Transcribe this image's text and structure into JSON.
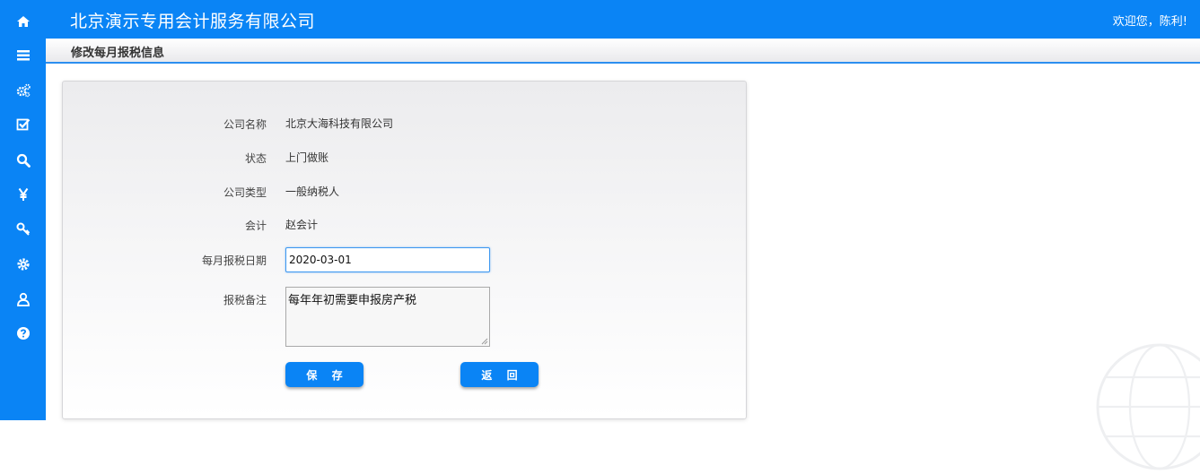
{
  "header": {
    "company_title": "北京演示专用会计服务有限公司",
    "welcome_text": "欢迎您，陈利!"
  },
  "page": {
    "title": "修改每月报税信息"
  },
  "sidebar": {
    "icons": [
      "home-icon",
      "list-icon",
      "gears-icon",
      "checkbox-icon",
      "search-icon",
      "yen-icon",
      "key-icon",
      "settings-icon",
      "user-icon",
      "help-icon"
    ],
    "accent_color": "#0a84f5"
  },
  "form": {
    "company_name_label": "公司名称",
    "company_name_value": "北京大海科技有限公司",
    "status_label": "状态",
    "status_value": "上门做账",
    "company_type_label": "公司类型",
    "company_type_value": "一般纳税人",
    "accountant_label": "会计",
    "accountant_value": "赵会计",
    "tax_date_label": "每月报税日期",
    "tax_date_value": "2020-03-01",
    "tax_note_label": "报税备注",
    "tax_note_value": "每年年初需要申报房产税",
    "save_label": "保 存",
    "back_label": "返 回"
  }
}
